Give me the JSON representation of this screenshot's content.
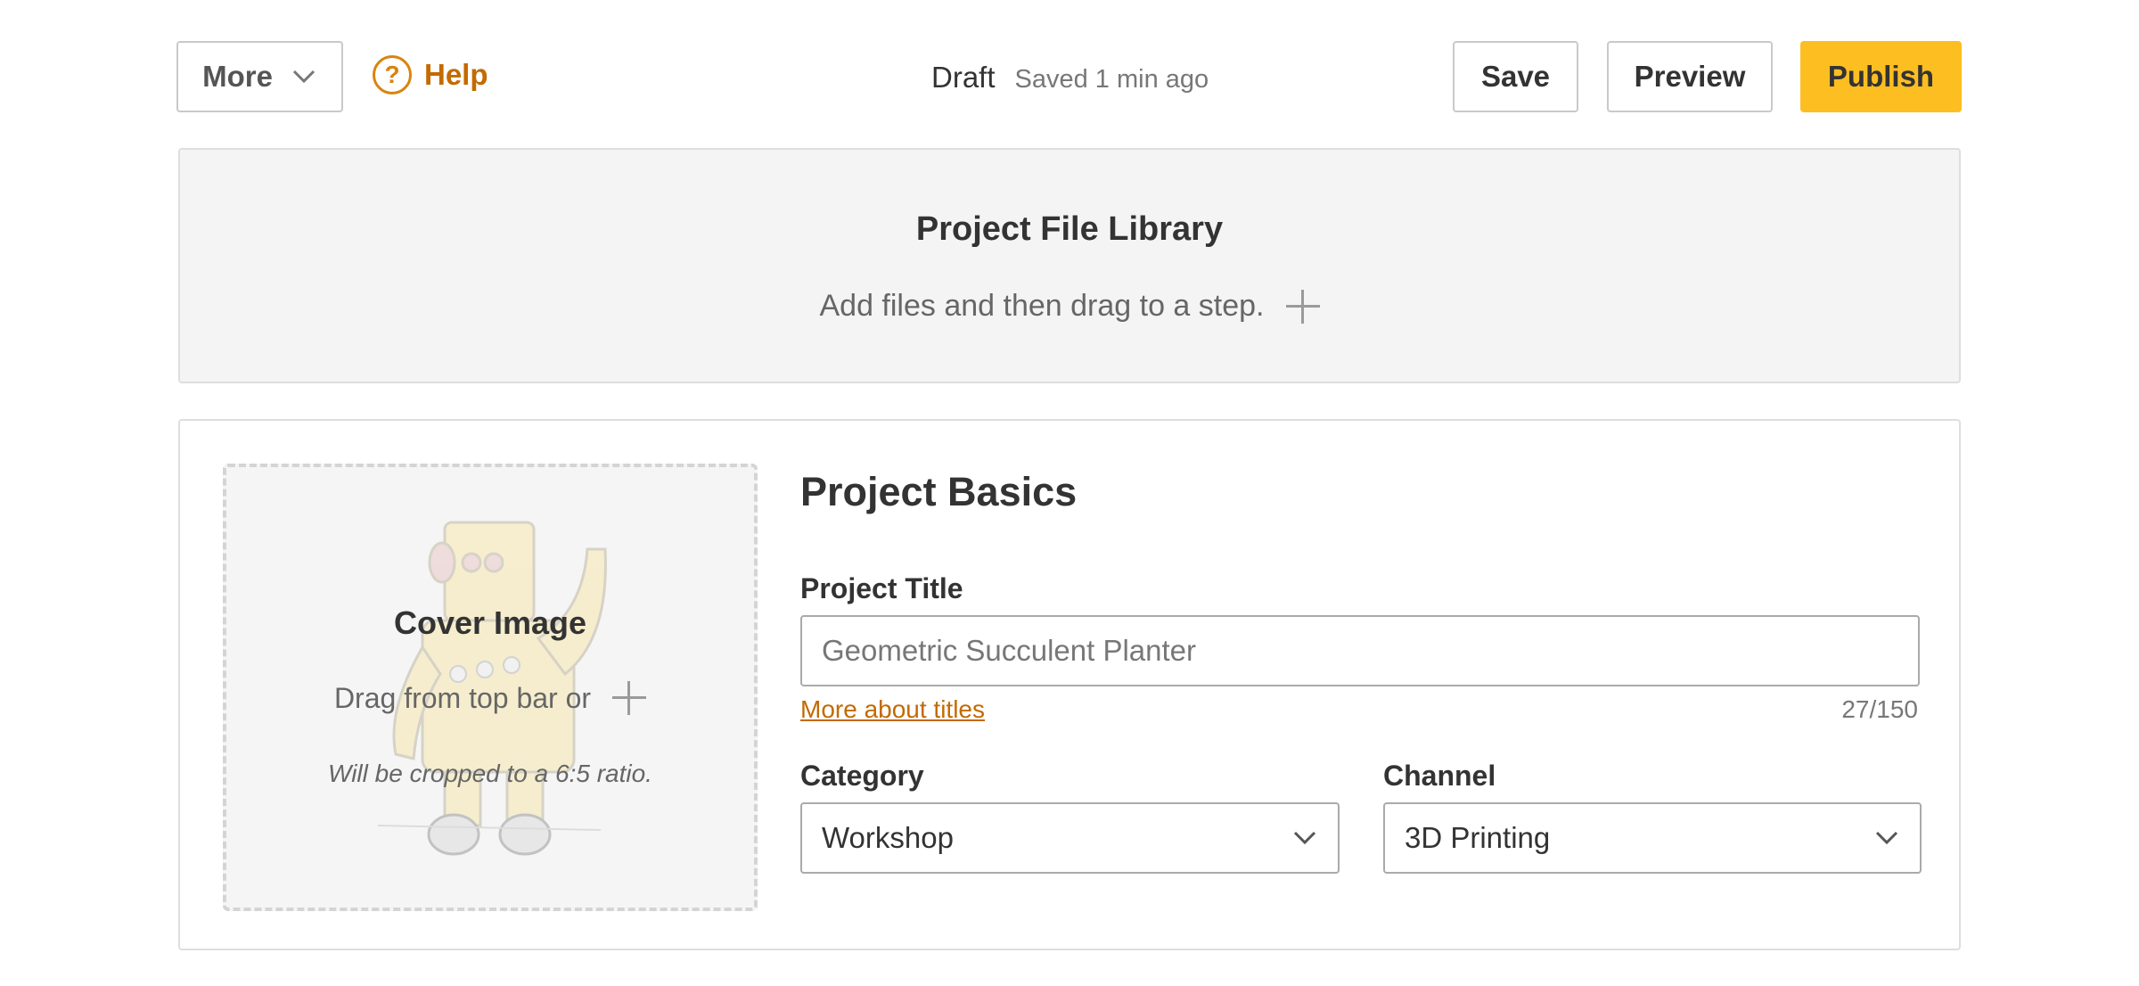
{
  "toolbar": {
    "more_label": "More",
    "help_label": "Help",
    "help_icon_glyph": "?",
    "status": "Draft",
    "saved_text": "Saved 1 min ago",
    "save_label": "Save",
    "preview_label": "Preview",
    "publish_label": "Publish"
  },
  "library": {
    "title": "Project File Library",
    "hint": "Add files and then drag to a step."
  },
  "cover": {
    "title": "Cover Image",
    "drag_hint": "Drag from top bar or",
    "crop_note": "Will be cropped to a 6:5 ratio."
  },
  "basics": {
    "heading": "Project Basics",
    "title_label": "Project Title",
    "title_placeholder": "Geometric Succulent Planter",
    "title_help_link": "More about titles",
    "title_counter": "27/150",
    "category_label": "Category",
    "category_value": "Workshop",
    "channel_label": "Channel",
    "channel_value": "3D Printing"
  },
  "colors": {
    "accent": "#c36a00",
    "publish": "#fcbe21",
    "panel_bg": "#f4f4f4",
    "border": "#dedede"
  },
  "icons": {
    "more": "chevron-down-icon",
    "help": "help-circle-icon",
    "add": "plus-icon",
    "select": "chevron-down-icon",
    "cover_placeholder": "robot-mascot-icon"
  }
}
